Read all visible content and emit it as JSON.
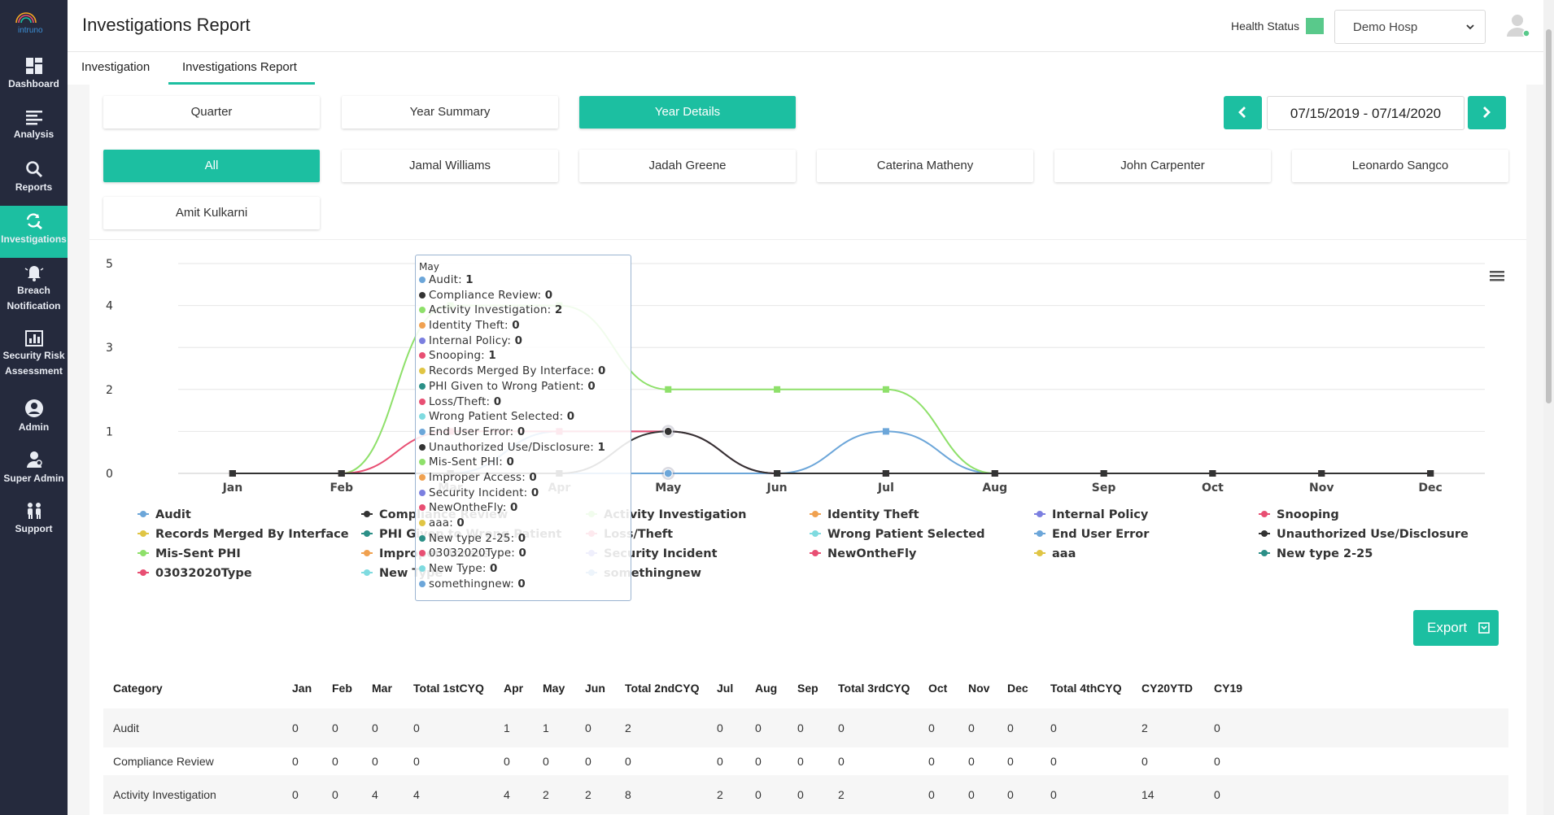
{
  "sidebar": {
    "logo_text": "intruno",
    "items": [
      {
        "label": "Dashboard",
        "icon": "dashboard-icon"
      },
      {
        "label": "Analysis",
        "icon": "list-icon"
      },
      {
        "label": "Reports",
        "icon": "search-icon"
      },
      {
        "label": "Investigations",
        "icon": "investigation-icon",
        "active": true
      },
      {
        "label": "Breach Notification",
        "icon": "bell-icon"
      },
      {
        "label": "Security Risk Assessment",
        "icon": "bar-chart-icon"
      },
      {
        "label": "Admin",
        "icon": "user-circle-icon"
      },
      {
        "label": "Super Admin",
        "icon": "super-admin-icon"
      },
      {
        "label": "Support",
        "icon": "people-icon"
      }
    ]
  },
  "header": {
    "title": "Investigations Report",
    "health_status_label": "Health Status",
    "health_status_color": "#59c98b",
    "hospital": "Demo Hosp"
  },
  "tabs": [
    {
      "label": "Investigation"
    },
    {
      "label": "Investigations Report",
      "active": true
    }
  ],
  "period_buttons": [
    {
      "label": "Quarter"
    },
    {
      "label": "Year Summary"
    },
    {
      "label": "Year Details",
      "selected": true
    }
  ],
  "date_range": "07/15/2019 - 07/14/2020",
  "people_filter": [
    {
      "label": "All",
      "selected": true
    },
    {
      "label": "Jamal Williams"
    },
    {
      "label": "Jadah Greene"
    },
    {
      "label": "Caterina Matheny"
    },
    {
      "label": "John Carpenter"
    },
    {
      "label": "Leonardo Sangco"
    },
    {
      "label": "Amit Kulkarni"
    }
  ],
  "chart_data": {
    "type": "line",
    "title": "",
    "xlabel": "",
    "ylabel": "",
    "ylim": [
      0,
      5
    ],
    "yticks": [
      "0",
      "1",
      "2",
      "3",
      "4",
      "5"
    ],
    "categories": [
      "Jan",
      "Feb",
      "Mar",
      "Apr",
      "May",
      "Jun",
      "Jul",
      "Aug",
      "Sep",
      "Oct",
      "Nov",
      "Dec"
    ],
    "grid": true,
    "legend_position": "bottom",
    "series": [
      {
        "name": "Audit",
        "color": "#6ca6d9",
        "values": [
          0,
          0,
          0,
          1,
          1,
          0,
          1,
          0,
          0,
          0,
          0,
          0
        ]
      },
      {
        "name": "Compliance Review",
        "color": "#333333",
        "values": [
          0,
          0,
          0,
          0,
          0,
          0,
          0,
          0,
          0,
          0,
          0,
          0
        ]
      },
      {
        "name": "Activity Investigation",
        "color": "#8ee06a",
        "values": [
          0,
          0,
          4,
          4,
          2,
          2,
          2,
          0,
          0,
          0,
          0,
          0
        ]
      },
      {
        "name": "Identity Theft",
        "color": "#f0a150",
        "values": [
          0,
          0,
          0,
          0,
          0,
          0,
          0,
          0,
          0,
          0,
          0,
          0
        ]
      },
      {
        "name": "Internal Policy",
        "color": "#7b7fe0",
        "values": [
          0,
          0,
          0,
          0,
          0,
          0,
          0,
          0,
          0,
          0,
          0,
          0
        ]
      },
      {
        "name": "Snooping",
        "color": "#e84f73",
        "values": [
          0,
          0,
          1,
          1,
          1,
          0,
          0,
          0,
          0,
          0,
          0,
          0
        ]
      },
      {
        "name": "Records Merged By Interface",
        "color": "#e0c544",
        "values": [
          0,
          0,
          0,
          0,
          0,
          0,
          0,
          0,
          0,
          0,
          0,
          0
        ]
      },
      {
        "name": "PHI Given to Wrong Patient",
        "color": "#2b8f87",
        "values": [
          0,
          0,
          0,
          0,
          0,
          0,
          0,
          0,
          0,
          0,
          0,
          0
        ]
      },
      {
        "name": "Loss/Theft",
        "color": "#e84f73",
        "values": [
          0,
          0,
          0,
          0,
          0,
          0,
          0,
          0,
          0,
          0,
          0,
          0
        ]
      },
      {
        "name": "Wrong Patient Selected",
        "color": "#7fdbe0",
        "values": [
          0,
          0,
          0,
          0,
          0,
          0,
          0,
          0,
          0,
          0,
          0,
          0
        ]
      },
      {
        "name": "End User Error",
        "color": "#6ca6d9",
        "values": [
          0,
          0,
          0,
          0,
          0,
          0,
          0,
          0,
          0,
          0,
          0,
          0
        ]
      },
      {
        "name": "Unauthorized Use/Disclosure",
        "color": "#333333",
        "values": [
          0,
          0,
          0,
          0,
          1,
          0,
          0,
          0,
          0,
          0,
          0,
          0
        ]
      },
      {
        "name": "Mis-Sent PHI",
        "color": "#8ee06a",
        "values": [
          0,
          0,
          0,
          0,
          0,
          0,
          0,
          0,
          0,
          0,
          0,
          0
        ]
      },
      {
        "name": "Improper Access",
        "color": "#f0a150",
        "values": [
          0,
          0,
          0,
          0,
          0,
          0,
          0,
          0,
          0,
          0,
          0,
          0
        ]
      },
      {
        "name": "Security Incident",
        "color": "#7b7fe0",
        "values": [
          0,
          0,
          0,
          0,
          0,
          0,
          0,
          0,
          0,
          0,
          0,
          0
        ]
      },
      {
        "name": "NewOntheFly",
        "color": "#e84f73",
        "values": [
          0,
          0,
          0,
          0,
          0,
          0,
          0,
          0,
          0,
          0,
          0,
          0
        ]
      },
      {
        "name": "aaa",
        "color": "#e0c544",
        "values": [
          0,
          0,
          0,
          0,
          0,
          0,
          0,
          0,
          0,
          0,
          0,
          0
        ]
      },
      {
        "name": "New type 2-25",
        "color": "#2b8f87",
        "values": [
          0,
          0,
          0,
          0,
          0,
          0,
          0,
          0,
          0,
          0,
          0,
          0
        ]
      },
      {
        "name": "03032020Type",
        "color": "#e84f73",
        "values": [
          0,
          0,
          0,
          0,
          0,
          0,
          0,
          0,
          0,
          0,
          0,
          0
        ]
      },
      {
        "name": "New Type",
        "color": "#7fdbe0",
        "values": [
          0,
          0,
          0,
          0,
          0,
          0,
          0,
          0,
          0,
          0,
          0,
          0
        ]
      },
      {
        "name": "somethingnew",
        "color": "#6ca6d9",
        "values": [
          0,
          0,
          0,
          0,
          0,
          0,
          0,
          0,
          0,
          0,
          0,
          0
        ]
      }
    ]
  },
  "tooltip": {
    "title": "May",
    "rows": [
      {
        "name": "Audit",
        "value": "1"
      },
      {
        "name": "Compliance Review",
        "value": "0"
      },
      {
        "name": "Activity Investigation",
        "value": "2"
      },
      {
        "name": "Identity Theft",
        "value": "0"
      },
      {
        "name": "Internal Policy",
        "value": "0"
      },
      {
        "name": "Snooping",
        "value": "1"
      },
      {
        "name": "Records Merged By Interface",
        "value": "0"
      },
      {
        "name": "PHI Given to Wrong Patient",
        "value": "0"
      },
      {
        "name": "Loss/Theft",
        "value": "0"
      },
      {
        "name": "Wrong Patient Selected",
        "value": "0"
      },
      {
        "name": "End User Error",
        "value": "0"
      },
      {
        "name": "Unauthorized Use/Disclosure",
        "value": "1"
      },
      {
        "name": "Mis-Sent PHI",
        "value": "0"
      },
      {
        "name": "Improper Access",
        "value": "0"
      },
      {
        "name": "Security Incident",
        "value": "0"
      },
      {
        "name": "NewOntheFly",
        "value": "0"
      },
      {
        "name": "aaa",
        "value": "0"
      },
      {
        "name": "New type 2-25",
        "value": "0"
      },
      {
        "name": "03032020Type",
        "value": "0"
      },
      {
        "name": "New Type",
        "value": "0"
      },
      {
        "name": "somethingnew",
        "value": "0"
      }
    ]
  },
  "export_label": "Export",
  "table": {
    "columns": [
      "Category",
      "Jan",
      "Feb",
      "Mar",
      "Total 1stCYQ",
      "Apr",
      "May",
      "Jun",
      "Total 2ndCYQ",
      "Jul",
      "Aug",
      "Sep",
      "Total 3rdCYQ",
      "Oct",
      "Nov",
      "Dec",
      "Total 4thCYQ",
      "CY20YTD",
      "CY19"
    ],
    "rows": [
      [
        "Audit",
        "0",
        "0",
        "0",
        "0",
        "1",
        "1",
        "0",
        "2",
        "0",
        "0",
        "0",
        "0",
        "0",
        "0",
        "0",
        "0",
        "2",
        "0"
      ],
      [
        "Compliance Review",
        "0",
        "0",
        "0",
        "0",
        "0",
        "0",
        "0",
        "0",
        "0",
        "0",
        "0",
        "0",
        "0",
        "0",
        "0",
        "0",
        "0",
        "0"
      ],
      [
        "Activity Investigation",
        "0",
        "0",
        "4",
        "4",
        "4",
        "2",
        "2",
        "8",
        "2",
        "0",
        "0",
        "2",
        "0",
        "0",
        "0",
        "0",
        "14",
        "0"
      ]
    ]
  }
}
